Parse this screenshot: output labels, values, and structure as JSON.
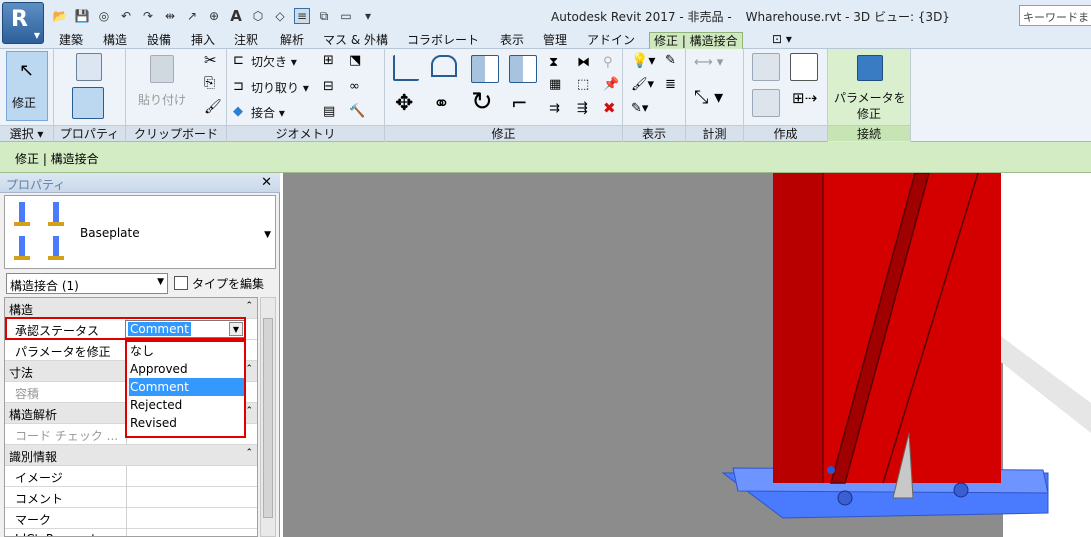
{
  "app": {
    "title": "Autodesk Revit 2017 - 非売品 -",
    "file": "Wharehouse.rvt - 3D ビュー: {3D}",
    "search_placeholder": "キーワードま"
  },
  "tabs": [
    "建築",
    "構造",
    "設備",
    "挿入",
    "注釈",
    "解析",
    "マス & 外構",
    "コラボレート",
    "表示",
    "管理",
    "アドイン",
    "修正 | 構造接合"
  ],
  "ribbon": {
    "modify_label": "修正",
    "paste_label": "貼り付け",
    "cut_label": "切欠き",
    "trim_label": "切り取り",
    "join_label": "接合",
    "param_label_1": "パラメータを",
    "param_label_2": "修正",
    "panels": {
      "select": "選択 ▾",
      "properties": "プロパティ",
      "clipboard": "クリップボード",
      "geometry": "ジオメトリ",
      "modify": "修正",
      "view": "表示",
      "measure": "計測",
      "create": "作成",
      "connection": "接続"
    }
  },
  "context_bar": "修正 | 構造接合",
  "properties": {
    "title": "プロパティ",
    "type_name": "Baseplate",
    "selector": "構造接合 (1)",
    "edit_type": "タイプを編集",
    "rows": [
      {
        "type": "group",
        "label": "構造"
      },
      {
        "type": "param",
        "label": "承認ステータス"
      },
      {
        "type": "param",
        "label": "パラメータを修正"
      },
      {
        "type": "group",
        "label": "寸法"
      },
      {
        "type": "param",
        "label": "容積",
        "dim": true
      },
      {
        "type": "group",
        "label": "構造解析"
      },
      {
        "type": "param",
        "label": "コード チェック ...",
        "dim": true
      },
      {
        "type": "group",
        "label": "識別情報"
      },
      {
        "type": "param",
        "label": "イメージ"
      },
      {
        "type": "param",
        "label": "コメント"
      },
      {
        "type": "param",
        "label": "マーク"
      },
      {
        "type": "param",
        "label": "IdCtcParameter"
      }
    ],
    "status_value": "Comment",
    "options": [
      "なし",
      "Approved",
      "Comment",
      "Rejected",
      "Revised"
    ],
    "highlighted_option": "Comment"
  },
  "colors": {
    "steel": "#d40000",
    "baseplate": "#4a7bff",
    "viewport_bg": "#8c8c8c"
  }
}
